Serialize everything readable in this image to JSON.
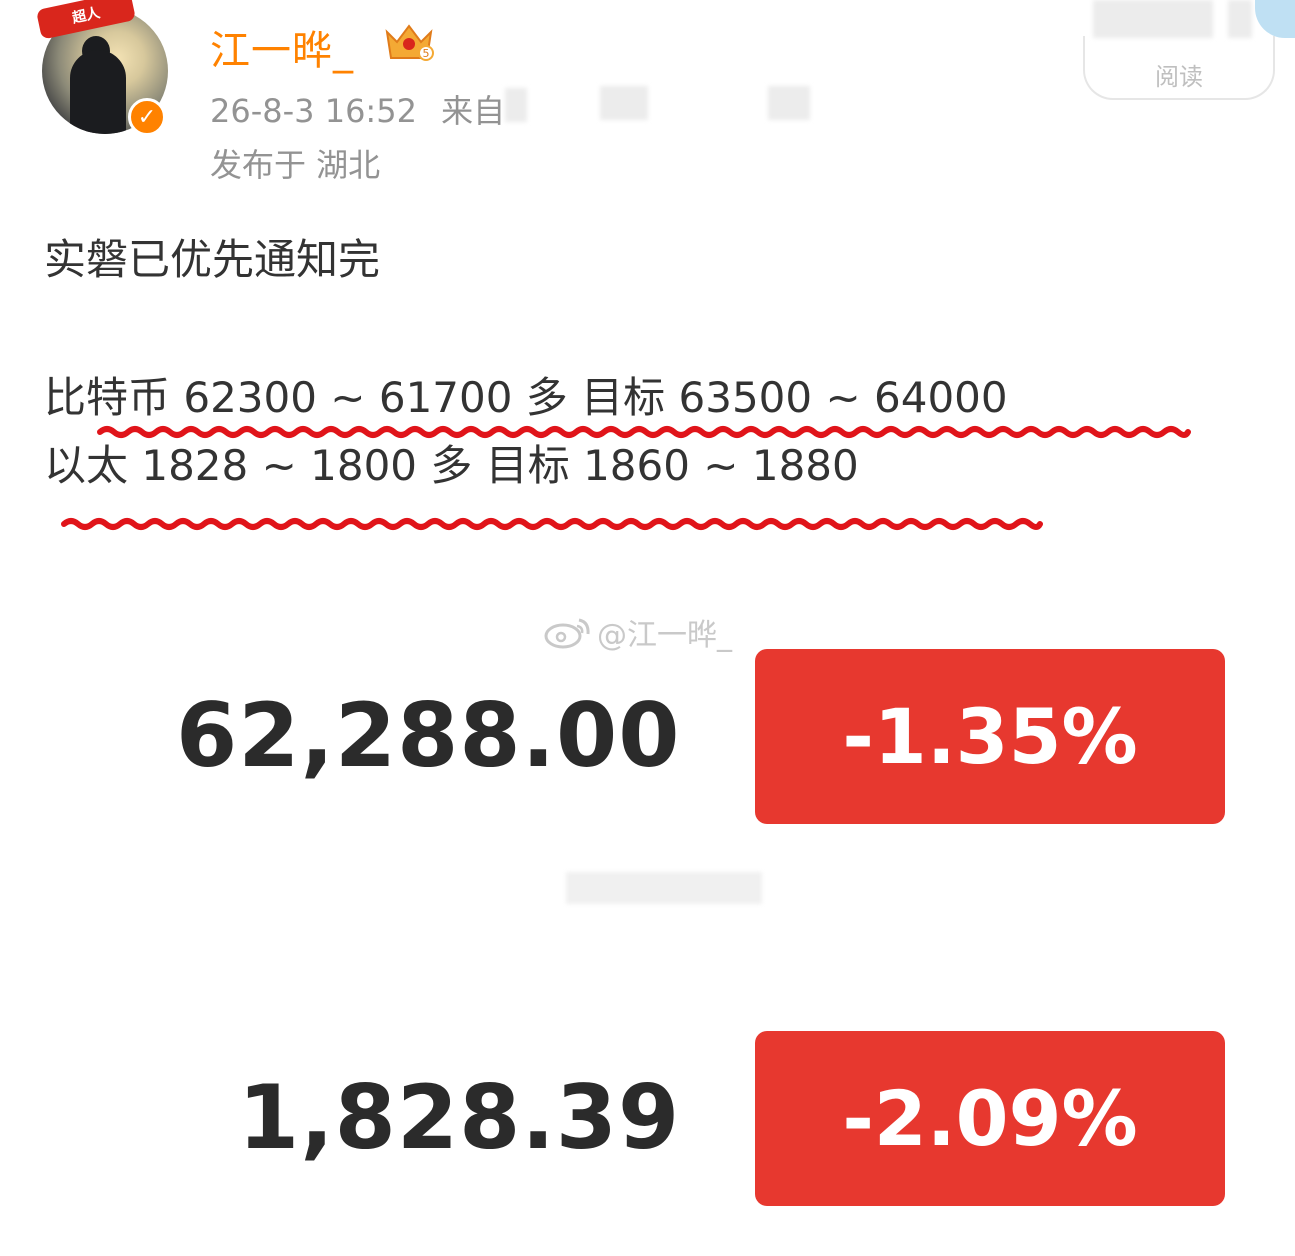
{
  "header": {
    "badge_text": "超人",
    "username": "江一晔_",
    "crown_level": "5",
    "timestamp": "26-8-3 16:52",
    "source_prefix": "来自",
    "location": "发布于 湖北",
    "read_button": "阅读"
  },
  "post": {
    "line1": "实磐已优先通知完",
    "line2": "比特币 62300 ~ 61700 多 目标 63500 ~ 64000",
    "line3": "以太 1828 ~ 1800 多 目标 1860 ~ 1880"
  },
  "image": {
    "watermark": "@江一晔_",
    "btc_price": "62,288.00",
    "btc_change": "-1.35%",
    "eth_price": "1,828.39",
    "eth_change": "-2.09%"
  },
  "colors": {
    "username": "#ff8200",
    "underline": "#e0141a",
    "change_box": "#e7382f"
  }
}
